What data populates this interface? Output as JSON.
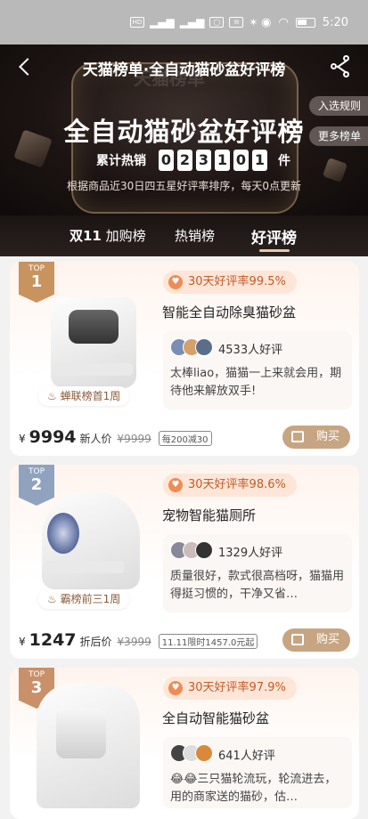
{
  "status_bar": {
    "time": "5:20",
    "icons": [
      "hd-icon",
      "signal-icon",
      "wifi-icon",
      "battery-icon"
    ]
  },
  "header": {
    "nav_title": "天猫榜单·全自动猫砂盆好评榜",
    "title": "全自动猫砂盆好评榜",
    "sales_label": "累计热销",
    "sales_digits": [
      "0",
      "2",
      "3",
      "1",
      "0",
      "1"
    ],
    "sales_unit": "件",
    "subtitle": "根据商品近30日四五星好评率排序，每天0点更新",
    "rules_label": "入选规则",
    "more_label": "更多榜单"
  },
  "tabs": [
    {
      "brand": "双11",
      "label": "加购榜",
      "active": false
    },
    {
      "label": "热销榜",
      "active": false
    },
    {
      "label": "好评榜",
      "active": true
    }
  ],
  "cards": [
    {
      "rank_top": "TOP",
      "rank": "1",
      "tagline": "蝉联榜首1周",
      "rate": "30天好评率99.5%",
      "name": "智能全自动除臭猫砂盆",
      "review_count": "4533人好评",
      "review_text": "太棒liao，猫猫一上来就会用，期待他来解放双手!",
      "price": "9994",
      "price_label": "新人价",
      "orig_price": "¥9999",
      "promo": "每200减30",
      "buy_label": "购买",
      "badge_color": "#c8935f"
    },
    {
      "rank_top": "TOP",
      "rank": "2",
      "tagline": "霸榜前三1周",
      "rate": "30天好评率98.6%",
      "name": "宠物智能猫厕所",
      "review_count": "1329人好评",
      "review_text": "质量很好，款式很高档呀，猫猫用得挺习惯的，干净又省…",
      "price": "1247",
      "price_label": "折后价",
      "orig_price": "¥3999",
      "promo": "11.11限时1457.0元起",
      "buy_label": "购买",
      "badge_color": "#8fa3bf"
    },
    {
      "rank_top": "TOP",
      "rank": "3",
      "rate": "30天好评率97.9%",
      "name": "全自动智能猫砂盆",
      "review_count": "641人好评",
      "review_text": "😂😂三只猫轮流玩，轮流进去，用的商家送的猫砂，估…",
      "badge_color": "#c9906a"
    }
  ]
}
